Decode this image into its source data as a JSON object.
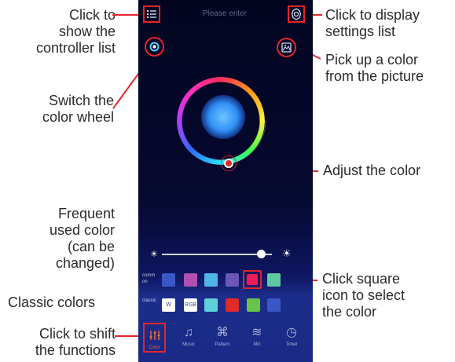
{
  "phone": {
    "search_placeholder": "Please enter",
    "icons": {
      "list": "list-icon",
      "settings": "gear-icon",
      "wheel_switch": "color-wheel-switch-icon",
      "picker": "image-picker-icon"
    },
    "brightness": 0.9,
    "common_label": "common",
    "classic_label": "classic",
    "common_swatches": [
      "#3b57c5",
      "#b24fb0",
      "#4fb5e6",
      "#6a57b8",
      "#ec1b5a",
      "#5cc9a0"
    ],
    "classic_swatches": [
      {
        "label": "W",
        "color": "#ffffff"
      },
      {
        "label": "RGB",
        "color": "#ffffff"
      },
      {
        "label": "",
        "color": "#5cd2d8"
      },
      {
        "label": "",
        "color": "#e02a2a"
      },
      {
        "label": "",
        "color": "#69c24a"
      },
      {
        "label": "",
        "color": "#3b57c5"
      }
    ],
    "tabs": [
      {
        "label": "Color",
        "icon": "equalizer-icon",
        "active": true
      },
      {
        "label": "Music",
        "icon": "music-note-icon",
        "active": false
      },
      {
        "label": "Pattern",
        "icon": "command-icon",
        "active": false
      },
      {
        "label": "Mic",
        "icon": "sound-wave-icon",
        "active": false
      },
      {
        "label": "Timer",
        "icon": "timer-icon",
        "active": false
      }
    ]
  },
  "annotations": {
    "controller_list": "Click to\nshow the\ncontroller list",
    "settings_list": "Click to display\nsettings list",
    "pick_color": "Pick up a color\nfrom the picture",
    "switch_wheel": "Switch the\ncolor wheel",
    "adjust_color": "Adjust the color",
    "frequent_color": "Frequent\nused color\n(can be\nchanged)",
    "classic_colors": "Classic colors",
    "click_square": "Click square\nicon to select\nthe color",
    "shift_functions": "Click to shift\nthe functions"
  },
  "colors": {
    "accent_red": "#e4252b",
    "active_tab": "#ef6a2a"
  }
}
